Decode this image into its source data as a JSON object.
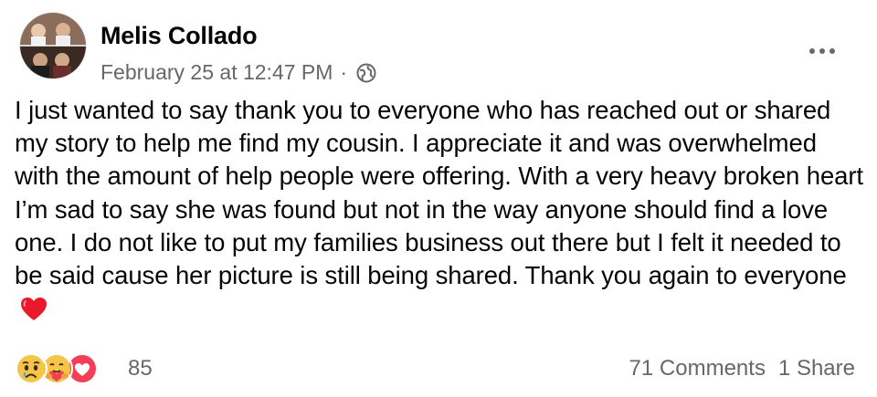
{
  "post": {
    "author": "Melis Collado",
    "timestamp": "February 25 at 12:47 PM",
    "separator": "·",
    "audience_icon": "globe-icon",
    "text": "I just wanted to say thank you to everyone who has reached out or shared my story to help me find my cousin. I appreciate it and was overwhelmed with the amount of help people were offering. With a very heavy broken heart I’m sad to say she was found but not in the way anyone should find a love one. I do not like to put my families business out there but I felt it needed to be said cause her picture is still being shared. Thank you again to everyone",
    "trailing_emoji": "red-heart-emoji"
  },
  "reactions": {
    "types": [
      "sad",
      "care",
      "love"
    ],
    "count": "85"
  },
  "stats": {
    "comments": "71 Comments",
    "shares": "1 Share"
  },
  "colors": {
    "text": "#050505",
    "secondary": "#65676b",
    "love": "#f33e58",
    "emoji_yellow": "#f7c44a"
  }
}
